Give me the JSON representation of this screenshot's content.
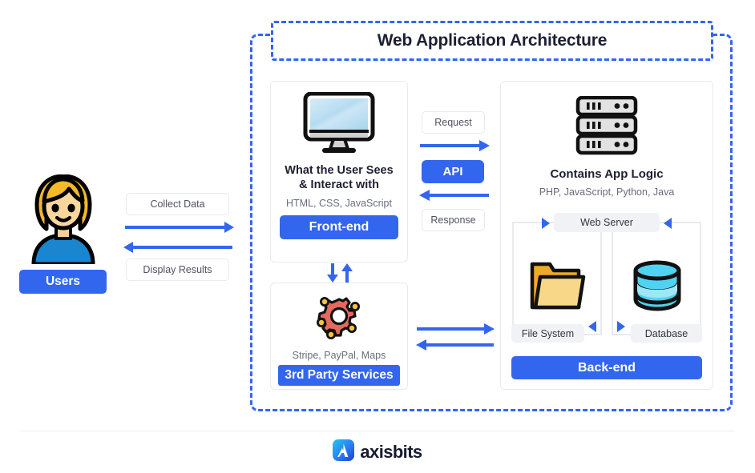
{
  "diagram": {
    "title": "Web Application Architecture",
    "accent_blue": "#3366ee",
    "frame_style": "dashed"
  },
  "users": {
    "badge_label": "Users",
    "avatar_icon": "user-avatar-icon",
    "flows": [
      {
        "label": "Collect Data",
        "direction": "right"
      },
      {
        "label": "Display Results",
        "direction": "left"
      }
    ]
  },
  "frontend": {
    "icon": "monitor-icon",
    "title": "What the User Sees\n& Interact with",
    "title_line1": "What the User Sees",
    "title_line2": "& Interact with",
    "technologies": "HTML, CSS, JavaScript",
    "badge_label": "Front-end"
  },
  "third_party": {
    "icon": "gear-network-icon",
    "technologies": "Stripe, PayPal, Maps",
    "badge_label": "3rd Party Services"
  },
  "api": {
    "request_label": "Request",
    "badge_label": "API",
    "response_label": "Response"
  },
  "backend": {
    "icon": "server-rack-icon",
    "title": "Contains App Logic",
    "technologies": "PHP, JavaScript, Python, Java",
    "badge_label": "Back-end",
    "web_server_label": "Web Server",
    "file_system_label": "File System",
    "database_label": "Database",
    "file_system_icon": "folder-icon",
    "database_icon": "database-cylinder-icon"
  },
  "footer": {
    "brand": "axisbits",
    "logo_icon": "axisbits-logo-icon"
  }
}
